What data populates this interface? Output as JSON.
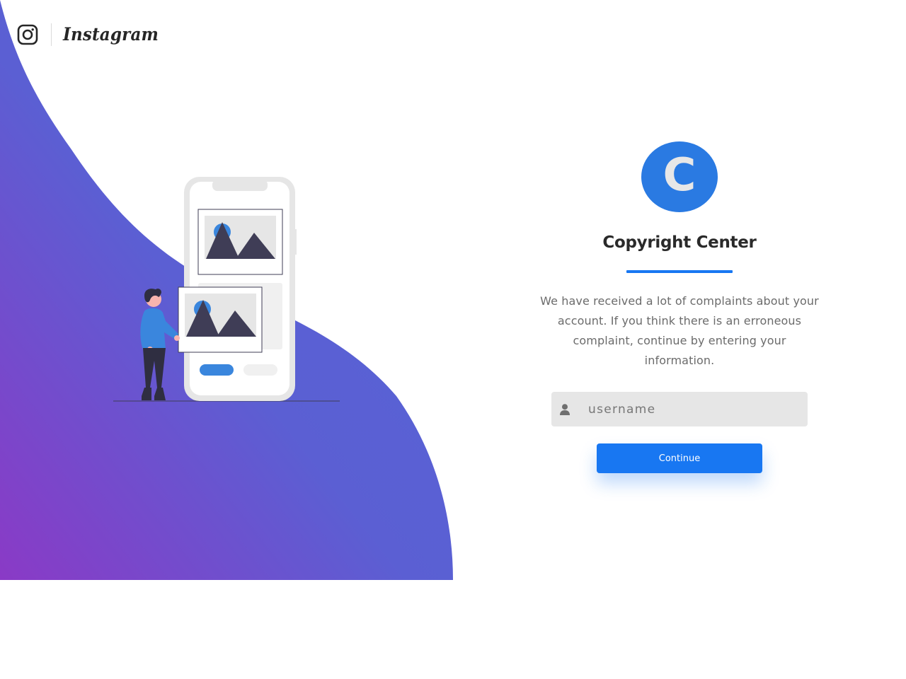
{
  "colors": {
    "accent": "#1877f2",
    "logo_circle": "#2a7ae2",
    "gradient_top": "#5466d6",
    "gradient_bottom": "#8a3ac6",
    "input_bg": "#e6e6e6"
  },
  "header": {
    "brand_icon": "instagram-camera-icon",
    "brand_name": "Instagram"
  },
  "illustration": {
    "icon": "person-with-phone-gallery-illustration"
  },
  "panel": {
    "logo_letter": "C",
    "title": "Copyright Center",
    "description": "We have received a lot of complaints about your account. If you think there is an erroneous complaint, continue by entering your information.",
    "username": {
      "icon": "user-icon",
      "value": "",
      "placeholder": "username"
    },
    "continue_label": "Continue"
  }
}
